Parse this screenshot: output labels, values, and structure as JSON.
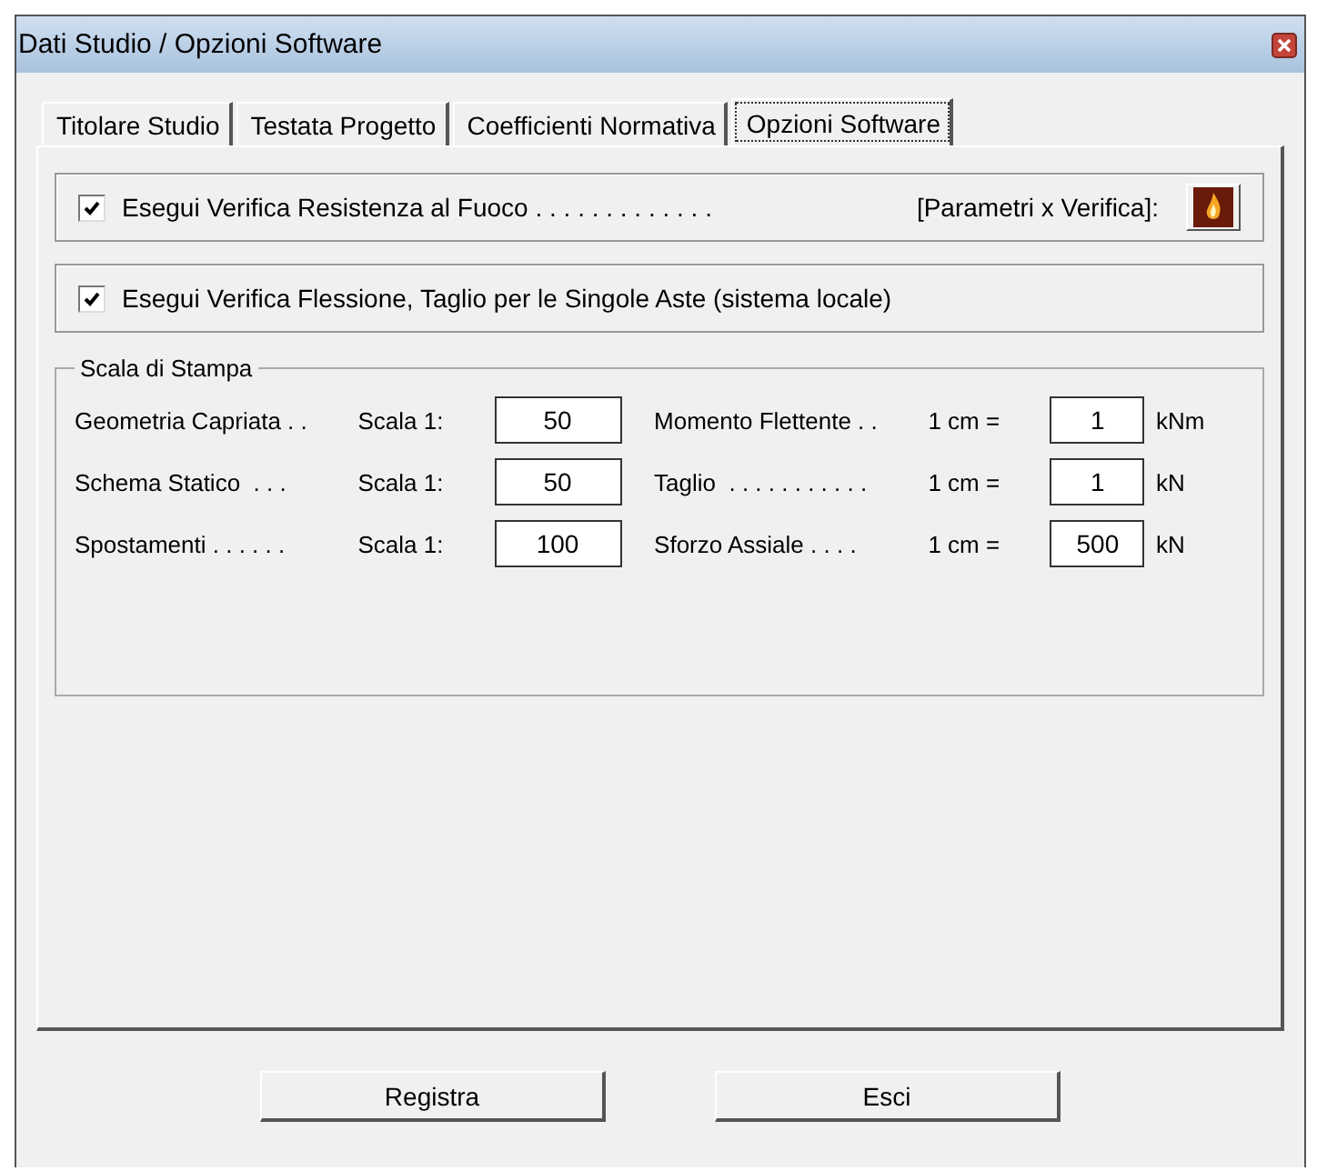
{
  "window": {
    "title": "Dati Studio / Opzioni Software"
  },
  "tabs": [
    {
      "label": "Titolare Studio",
      "selected": false
    },
    {
      "label": "Testata Progetto",
      "selected": false
    },
    {
      "label": "Coefficienti Normativa",
      "selected": false
    },
    {
      "label": "Opzioni Software",
      "selected": true
    }
  ],
  "options": [
    {
      "label": "Esegui Verifica Resistenza al Fuoco . . . . . . . . . . . . .",
      "checked": true,
      "extra_label": "[Parametri x Verifica]:"
    },
    {
      "label": "Esegui Verifica Flessione, Taglio per le Singole Aste (sistema locale)",
      "checked": true
    }
  ],
  "print_scale": {
    "title": "Scala di Stampa",
    "rows": [
      {
        "label": "Geometria Capriata . .",
        "scale_label": "Scala 1:",
        "scale": "50",
        "quantity": "Momento Flettente . .",
        "unit_label": "1 cm =",
        "value": "1",
        "unit": "kNm"
      },
      {
        "label": "Schema Statico  . . .",
        "scale_label": "Scala 1:",
        "scale": "50",
        "quantity": "Taglio  . . . . . . . . . . .",
        "unit_label": "1 cm =",
        "value": "1",
        "unit": "kN"
      },
      {
        "label": "Spostamenti . . . . . .",
        "scale_label": "Scala 1:",
        "scale": "100",
        "quantity": "Sforzo Assiale . . . .",
        "unit_label": "1 cm =",
        "value": "500",
        "unit": "kN"
      }
    ]
  },
  "buttons": [
    "Registra",
    "Esci"
  ]
}
